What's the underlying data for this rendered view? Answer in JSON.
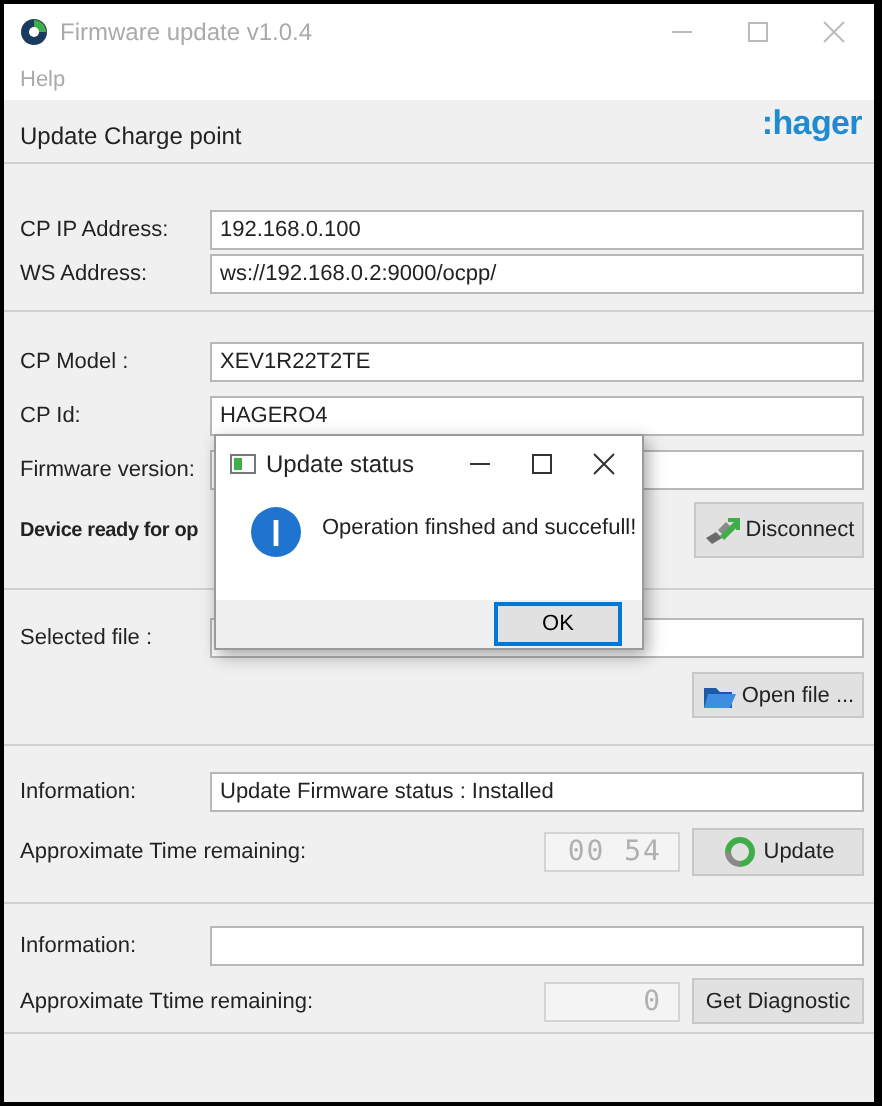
{
  "window": {
    "title": "Firmware update v1.0.4",
    "active": false
  },
  "menu": [
    "Help"
  ],
  "panel": {
    "title": "Update Charge point",
    "logo": ":hager"
  },
  "connection_fields": [
    {
      "label": "CP IP Address:",
      "value": "192.168.0.100"
    },
    {
      "label": "WS Address:",
      "value": "ws://192.168.0.2:9000/ocpp/"
    }
  ],
  "device_fields": [
    {
      "label": "CP Model :",
      "value": "XEV1R22T2TE"
    },
    {
      "label": "CP Id:",
      "value": "HAGERO4"
    },
    {
      "label": "Firmware version:"
    }
  ],
  "device_status": "Device ready for op",
  "disconnect_button": "Disconnect",
  "file": {
    "label": "Selected file :",
    "button": "Open file ..."
  },
  "update": {
    "info_label": "Information:",
    "info_value": "Update Firmware status : Installed",
    "time_label": "Approximate Time remaining:",
    "timer": "00 54",
    "button": "Update"
  },
  "diagnostic": {
    "info_label": "Information:",
    "time_label": "Approximate Ttime remaining:",
    "timer": "0",
    "button": "Get Diagnostic"
  },
  "dialog": {
    "title": "Update status",
    "message": "Operation finshed and succefull!",
    "button": "OK"
  }
}
